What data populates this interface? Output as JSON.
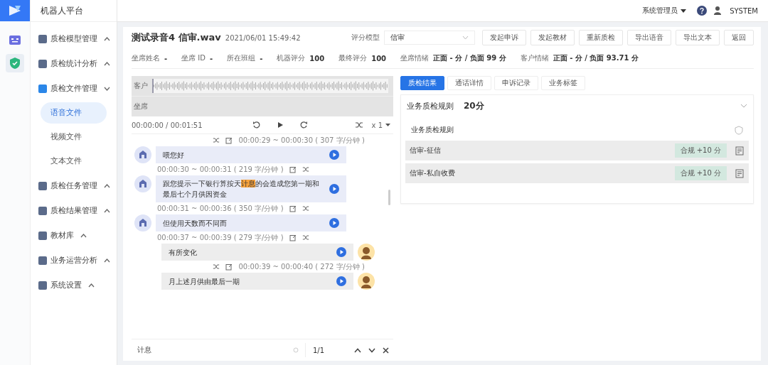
{
  "app": {
    "title": "机器人平台"
  },
  "sidebar": {
    "items": [
      {
        "label": "质检模型管理",
        "expanded": false
      },
      {
        "label": "质检统计分析",
        "expanded": false
      },
      {
        "label": "质检文件管理",
        "expanded": true,
        "children": [
          {
            "label": "语音文件",
            "selected": true
          },
          {
            "label": "视频文件",
            "selected": false
          },
          {
            "label": "文本文件",
            "selected": false
          }
        ]
      },
      {
        "label": "质检任务管理",
        "expanded": false
      },
      {
        "label": "质检结果管理",
        "expanded": false
      },
      {
        "label": "教材库",
        "expanded": false
      },
      {
        "label": "业务运营分析",
        "expanded": false
      },
      {
        "label": "系统设置",
        "expanded": false
      }
    ]
  },
  "header": {
    "role": "系统管理员",
    "user": "SYSTEM"
  },
  "record": {
    "title": "测试录音4 信审.wav",
    "time": "2021/06/01 15:49:42",
    "model_label": "评分模型",
    "model_value": "信审",
    "buttons": [
      "发起申诉",
      "发起教材",
      "重新质检",
      "导出语音",
      "导出文本",
      "返回"
    ],
    "info": [
      {
        "label": "坐席姓名",
        "value": "-"
      },
      {
        "label": "坐席 ID",
        "value": "-"
      },
      {
        "label": "所在班组",
        "value": "-"
      },
      {
        "label": "机器评分",
        "value": "100"
      },
      {
        "label": "最终评分",
        "value": "100"
      },
      {
        "label": "坐席情绪",
        "value": "正面 - 分 / 负面 99 分"
      },
      {
        "label": "客户情绪",
        "value": "正面 - 分 / 负面 93.71 分"
      }
    ]
  },
  "player": {
    "tracks": [
      "客户",
      "坐席"
    ],
    "time": "00:00:00 / 00:01:51",
    "speed": "x 1"
  },
  "chat": [
    {
      "kind": "customer",
      "meta": "00:00:29 ~ 00:00:30 ( 307 字/分钟 )"
    },
    {
      "kind": "agent",
      "text": "喂您好",
      "meta": "00:00:30 ~ 00:00:31 ( 219 字/分钟 )"
    },
    {
      "kind": "agent",
      "text": "跟您提示一下银行算按天**计息**的会造成您第一期和最后七个月供因资金",
      "meta": "00:00:31 ~ 00:00:36 ( 350 字/分钟 )"
    },
    {
      "kind": "agent",
      "text": "但使用天数而不同而",
      "meta": "00:00:37 ~ 00:00:39 ( 279 字/分钟 )"
    },
    {
      "kind": "customer",
      "text": "有所变化",
      "meta": "00:00:39 ~ 00:00:40 ( 272 字/分钟 )"
    },
    {
      "kind": "customer",
      "text": "月上述月供由最后一期"
    }
  ],
  "search": {
    "value": "计息",
    "count": "1/1"
  },
  "tabs": [
    {
      "label": "质检结果",
      "selected": true
    },
    {
      "label": "通话详情",
      "selected": false
    },
    {
      "label": "申诉记录",
      "selected": false
    },
    {
      "label": "业务标签",
      "selected": false
    }
  ],
  "rules": {
    "title": "业务质检规则",
    "score": "20分",
    "subtitle": "业务质检规则",
    "rows": [
      {
        "name": "信审-征信",
        "tag": "合规 +10 分"
      },
      {
        "name": "信审-私自收费",
        "tag": "合规 +10 分"
      }
    ]
  }
}
